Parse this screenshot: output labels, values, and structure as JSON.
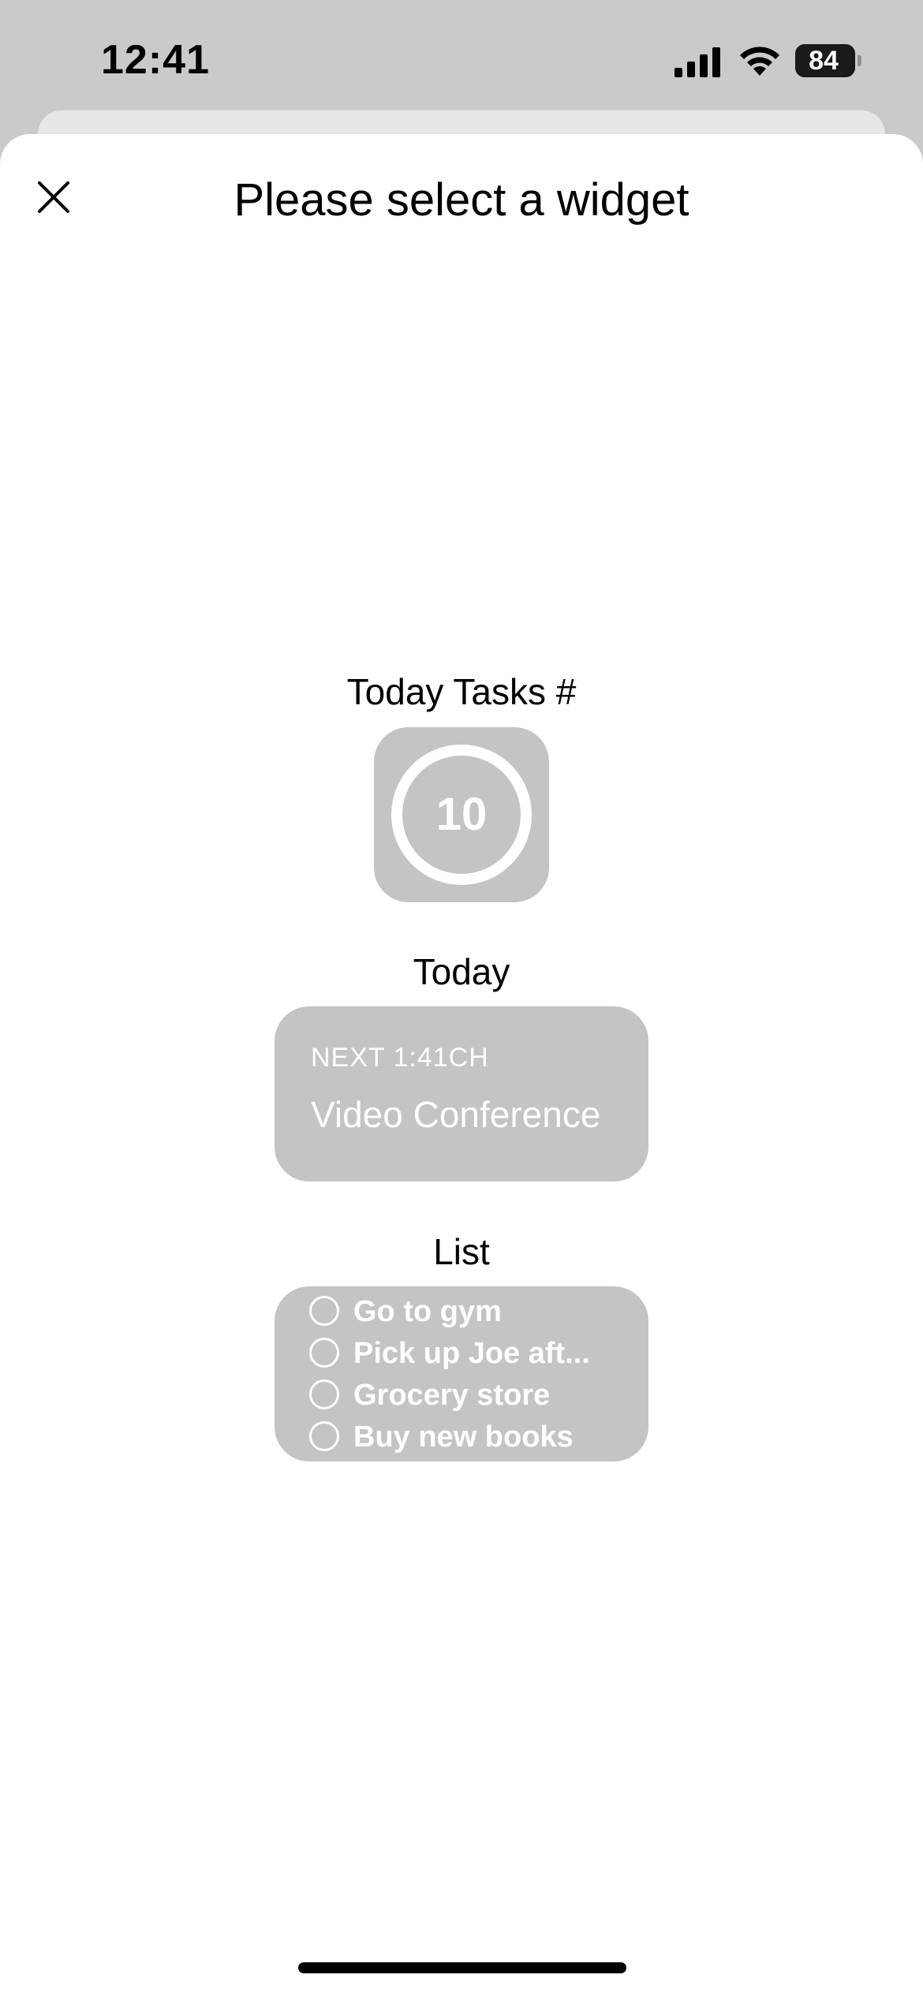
{
  "status_bar": {
    "time": "12:41",
    "battery": "84"
  },
  "sheet": {
    "title": "Please select a widget"
  },
  "widgets": {
    "today_tasks": {
      "label": "Today Tasks #",
      "count": "10"
    },
    "today": {
      "label": "Today",
      "next": "NEXT  1:41CH",
      "event": "Video Conference"
    },
    "list": {
      "label": "List",
      "items": [
        "Go to gym",
        "Pick up Joe aft...",
        "Grocery store",
        "Buy new books"
      ]
    }
  },
  "colors": {
    "widget_bg": "#c4c4c6",
    "sheet_bg": "#ffffff",
    "backdrop": "#c9cac9"
  }
}
